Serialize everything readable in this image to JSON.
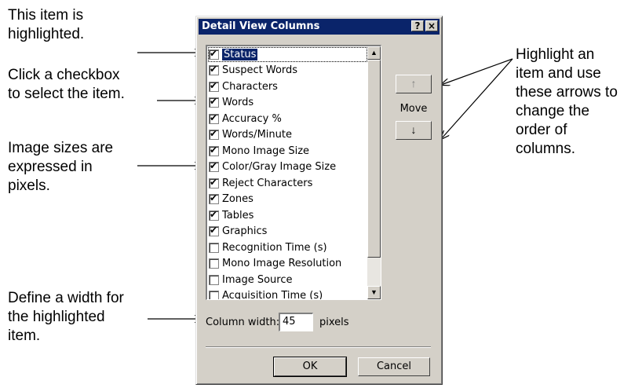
{
  "annotations": {
    "highlighted": "This item is\nhighlighted.",
    "checkbox": "Click a checkbox\nto select the item.",
    "image_sizes": "Image sizes are\nexpressed in\npixels.",
    "width": "Define a width for\nthe highlighted\nitem.",
    "arrows": "Highlight an\nitem and use\nthese arrows to\nchange the\norder of\ncolumns."
  },
  "dialog": {
    "title": "Detail View Columns",
    "help_button": "?",
    "close_button": "×",
    "items": [
      {
        "label": "Status",
        "checked": true,
        "selected": true
      },
      {
        "label": "Suspect Words",
        "checked": true
      },
      {
        "label": "Characters",
        "checked": true
      },
      {
        "label": "Words",
        "checked": true
      },
      {
        "label": "Accuracy %",
        "checked": true
      },
      {
        "label": "Words/Minute",
        "checked": true
      },
      {
        "label": "Mono Image Size",
        "checked": true
      },
      {
        "label": "Color/Gray Image Size",
        "checked": true
      },
      {
        "label": "Reject Characters",
        "checked": true
      },
      {
        "label": "Zones",
        "checked": true
      },
      {
        "label": "Tables",
        "checked": true
      },
      {
        "label": "Graphics",
        "checked": true
      },
      {
        "label": "Recognition Time (s)",
        "checked": false
      },
      {
        "label": "Mono Image Resolution",
        "checked": false
      },
      {
        "label": "Image Source",
        "checked": false
      },
      {
        "label": "Acquisition Time (s)",
        "checked": false
      }
    ],
    "move_label": "Move",
    "move_up": "↑",
    "move_down": "↓",
    "column_width_label": "Column width:",
    "column_width_value": "45",
    "column_width_units": "pixels",
    "ok_label": "OK",
    "cancel_label": "Cancel"
  }
}
